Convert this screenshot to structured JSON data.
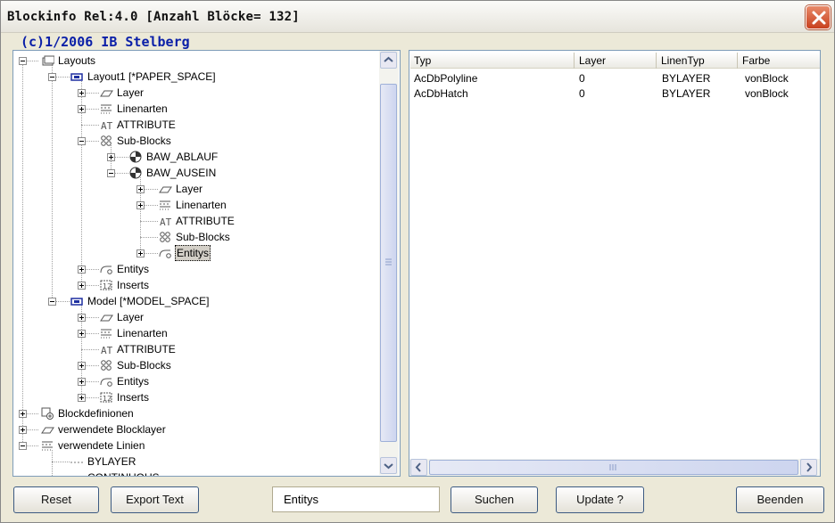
{
  "window": {
    "title": "Blockinfo Rel:4.0  [Anzahl Blöcke= 132]",
    "subtitle": "(c)1/2006 IB Stelberg"
  },
  "tree": {
    "items": [
      {
        "label": "Layouts",
        "icon": "layouts-icon",
        "expander": "minus"
      },
      {
        "label": "Layout1  [*PAPER_SPACE]",
        "icon": "layout-icon",
        "expander": "minus"
      },
      {
        "label": "Layer",
        "icon": "layer-icon",
        "expander": "plus"
      },
      {
        "label": "Linenarten",
        "icon": "linetype-icon",
        "expander": "plus"
      },
      {
        "label": "ATTRIBUTE",
        "icon": "attribute-icon",
        "expander": "none"
      },
      {
        "label": "Sub-Blocks",
        "icon": "subblocks-icon",
        "expander": "minus"
      },
      {
        "label": "BAW_ABLAUF",
        "icon": "block-icon",
        "expander": "plus"
      },
      {
        "label": "BAW_AUSEIN",
        "icon": "block-icon",
        "expander": "minus"
      },
      {
        "label": "Layer",
        "icon": "layer-icon",
        "expander": "plus"
      },
      {
        "label": "Linenarten",
        "icon": "linetype-icon",
        "expander": "plus"
      },
      {
        "label": "ATTRIBUTE",
        "icon": "attribute-icon",
        "expander": "none"
      },
      {
        "label": "Sub-Blocks",
        "icon": "subblocks-icon",
        "expander": "none"
      },
      {
        "label": "Entitys",
        "icon": "entity-icon",
        "expander": "plus",
        "selected": true
      },
      {
        "label": "Entitys",
        "icon": "entity-icon",
        "expander": "plus"
      },
      {
        "label": "Inserts",
        "icon": "insert-icon",
        "expander": "plus"
      },
      {
        "label": "Model  [*MODEL_SPACE]",
        "icon": "layout-icon",
        "expander": "minus"
      },
      {
        "label": "Layer",
        "icon": "layer-icon",
        "expander": "plus"
      },
      {
        "label": "Linenarten",
        "icon": "linetype-icon",
        "expander": "plus"
      },
      {
        "label": "ATTRIBUTE",
        "icon": "attribute-icon",
        "expander": "none"
      },
      {
        "label": "Sub-Blocks",
        "icon": "subblocks-icon",
        "expander": "plus"
      },
      {
        "label": "Entitys",
        "icon": "entity-icon",
        "expander": "plus"
      },
      {
        "label": "Inserts",
        "icon": "insert-icon",
        "expander": "plus"
      },
      {
        "label": "Blockdefinionen",
        "icon": "blockdef-icon",
        "expander": "plus"
      },
      {
        "label": "verwendete Blocklayer",
        "icon": "layer-icon",
        "expander": "plus"
      },
      {
        "label": "verwendete Linien",
        "icon": "linetype-icon",
        "expander": "minus"
      },
      {
        "label": "BYLAYER",
        "icon": "line-sample-icon",
        "expander": "none"
      },
      {
        "label": "CONTINUOUS",
        "icon": "line-sample-icon",
        "expander": "none"
      }
    ]
  },
  "list": {
    "columns": [
      "Typ",
      "Layer",
      "LinenTyp",
      "Farbe"
    ],
    "rows": [
      [
        "AcDbPolyline",
        "0",
        "BYLAYER",
        "vonBlock"
      ],
      [
        "AcDbHatch",
        "0",
        "BYLAYER",
        "vonBlock"
      ]
    ]
  },
  "buttons": {
    "reset": "Reset",
    "export": "Export Text",
    "search": "Suchen",
    "update": "Update ?",
    "quit": "Beenden"
  },
  "search_field": {
    "value": "Entitys"
  }
}
